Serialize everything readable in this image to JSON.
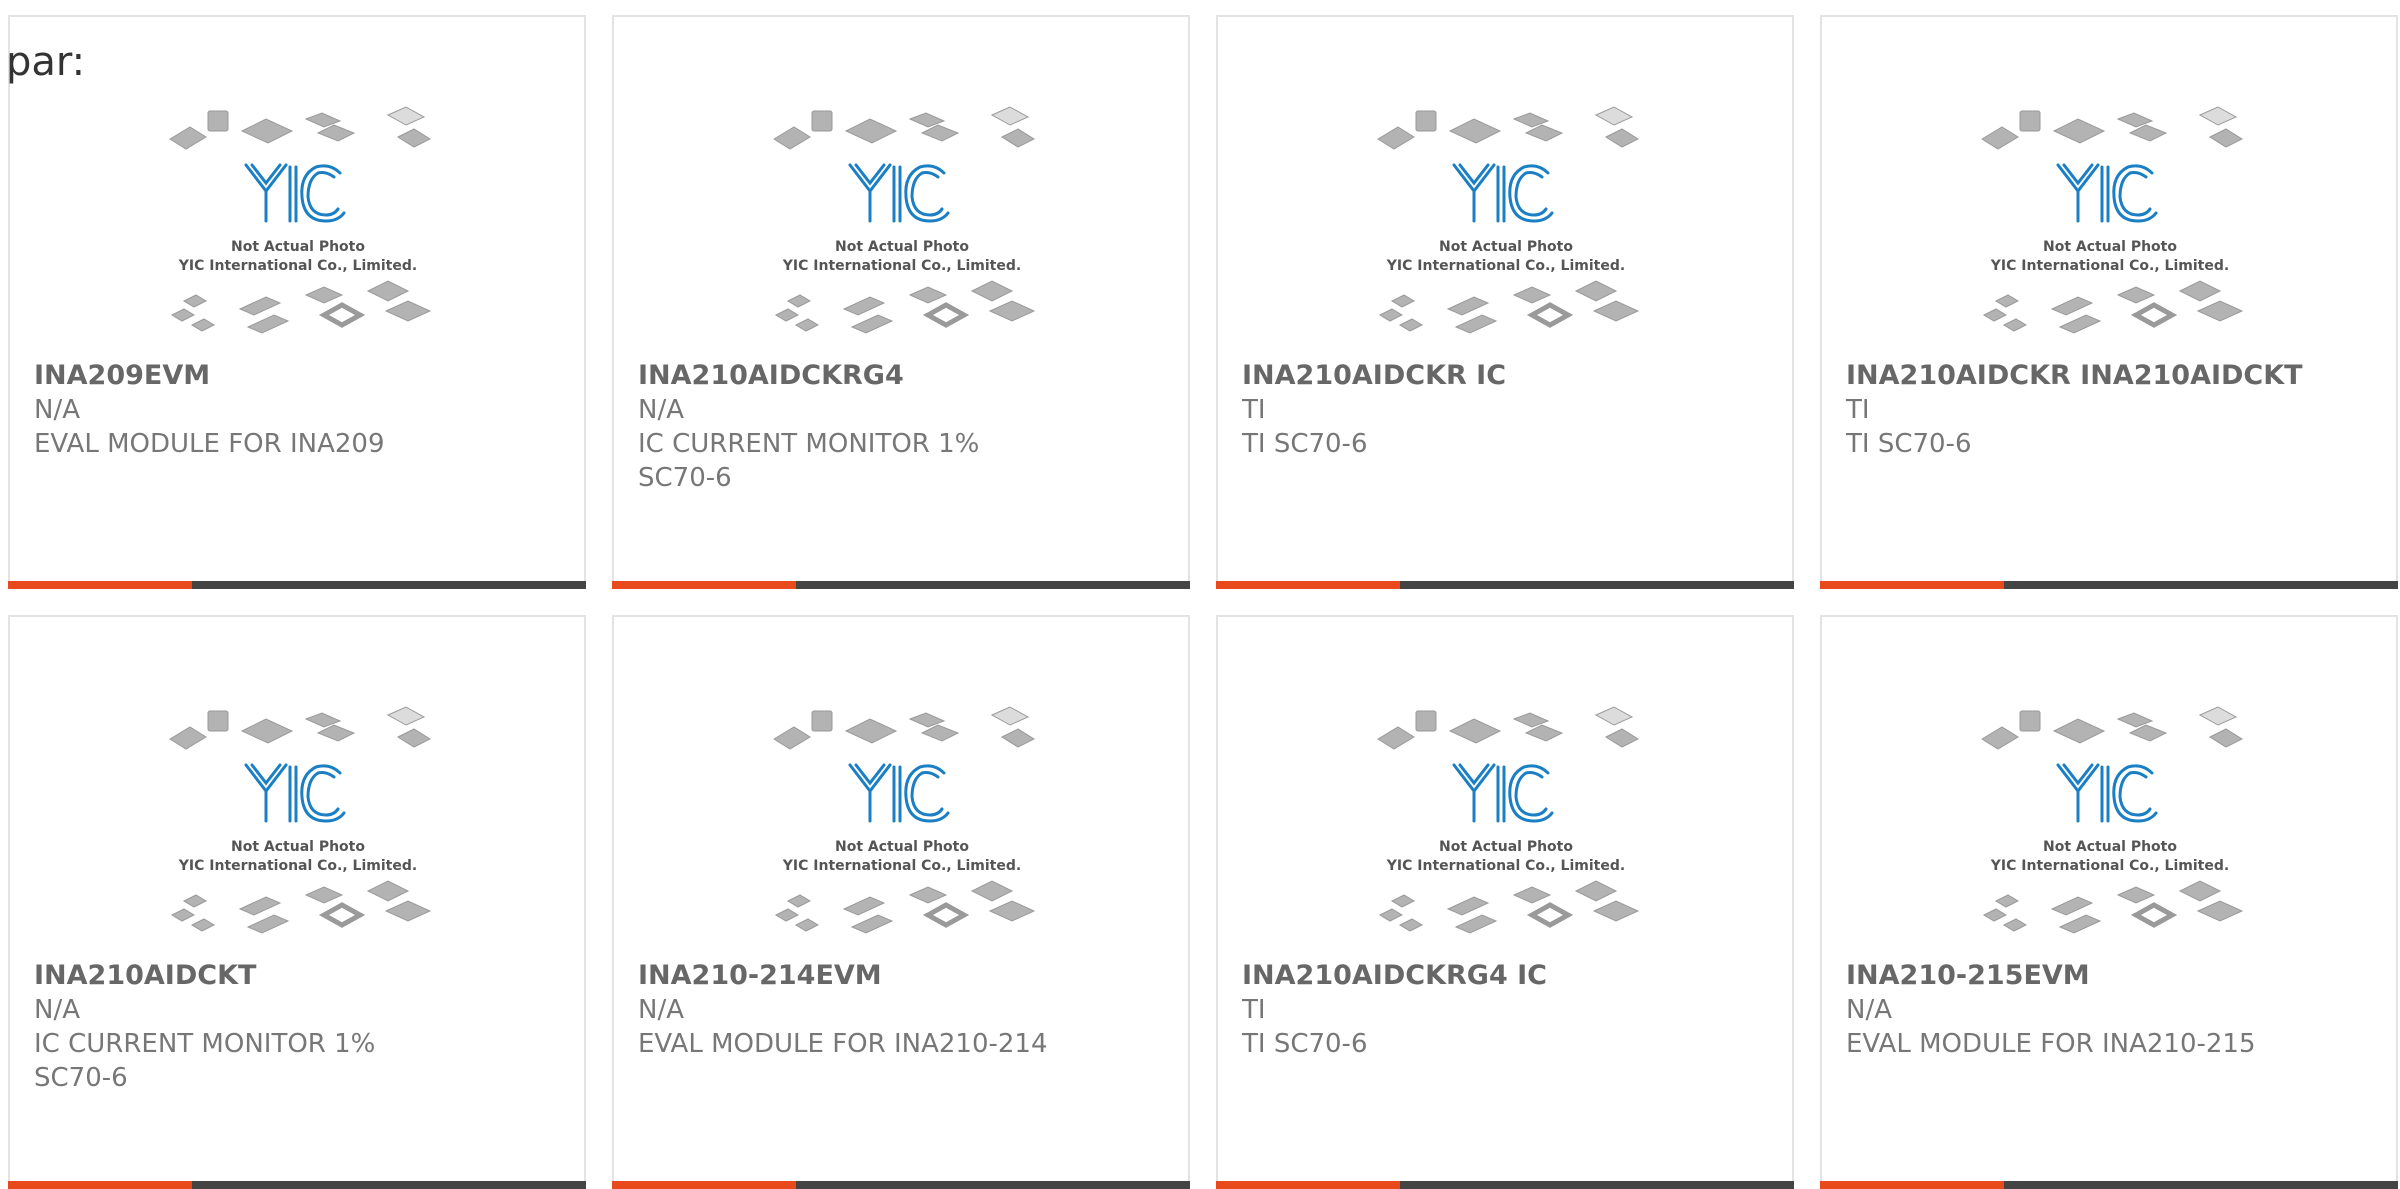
{
  "prefix": "par:",
  "placeholder": {
    "line1": "Not Actual Photo",
    "line2": "YIC International Co., Limited.",
    "logo_text": "YIC"
  },
  "colors": {
    "accent": "#e84a1c",
    "bar": "#444444",
    "logo": "#1a7fc4"
  },
  "products": [
    {
      "part": "INA209EVM",
      "brand": "N/A",
      "desc": "EVAL MODULE FOR INA209"
    },
    {
      "part": "INA210AIDCKRG4",
      "brand": "N/A",
      "desc": "IC CURRENT MONITOR 1% SC70-6"
    },
    {
      "part": "INA210AIDCKR IC",
      "brand": "TI",
      "desc": "TI SC70-6"
    },
    {
      "part": "INA210AIDCKR INA210AIDCKT",
      "brand": "TI",
      "desc": "TI SC70-6"
    },
    {
      "part": "INA210AIDCKT",
      "brand": "N/A",
      "desc": "IC CURRENT MONITOR 1% SC70-6"
    },
    {
      "part": "INA210-214EVM",
      "brand": "N/A",
      "desc": "EVAL MODULE FOR INA210-214"
    },
    {
      "part": "INA210AIDCKRG4 IC",
      "brand": "TI",
      "desc": "TI SC70-6"
    },
    {
      "part": "INA210-215EVM",
      "brand": "N/A",
      "desc": "EVAL MODULE FOR INA210-215"
    }
  ]
}
